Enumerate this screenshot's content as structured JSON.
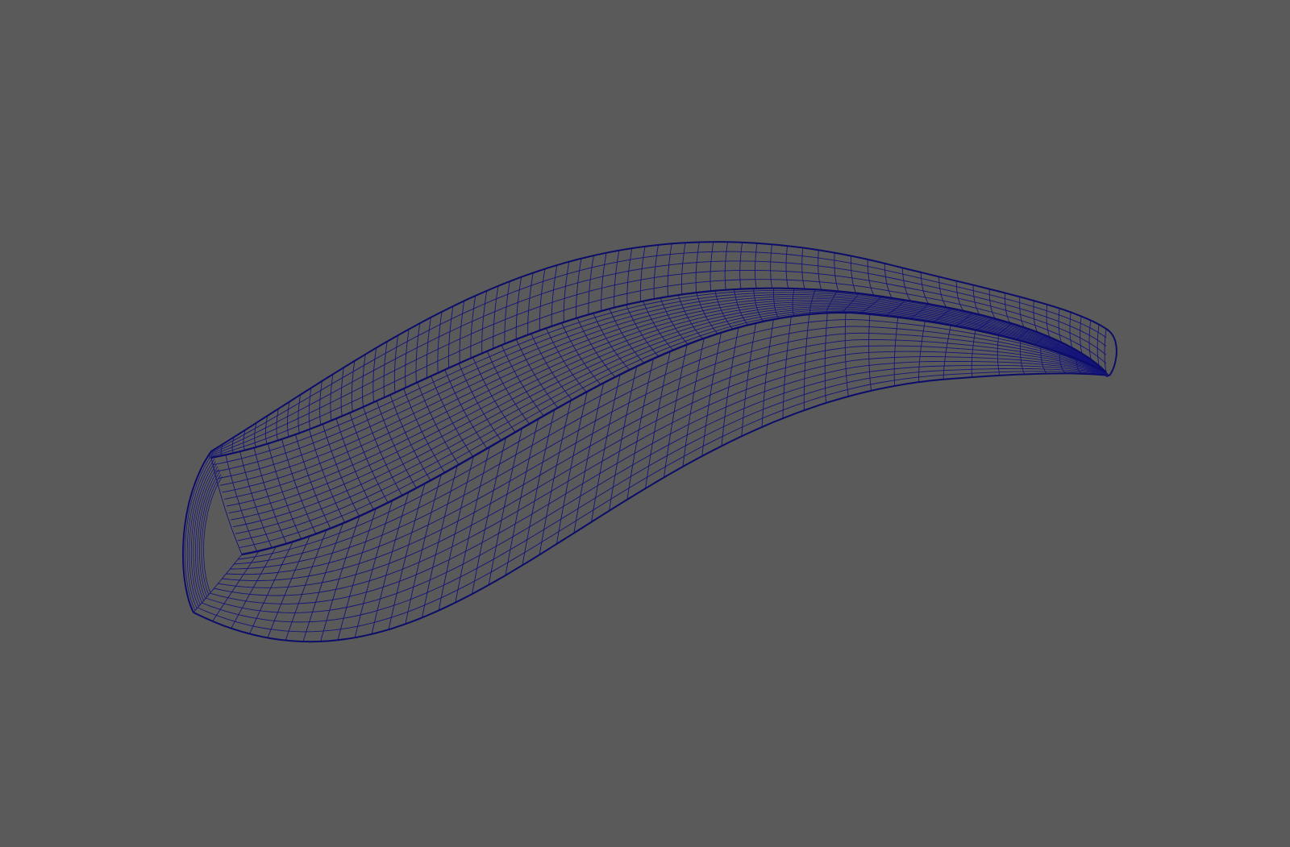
{
  "viewport": {
    "background_color": "#5a5a5a",
    "display_mode": "wireframe"
  },
  "mesh": {
    "object": "curved-surface-body",
    "wire_color": "#14147a",
    "edge_color": "#0c0c6a",
    "icon": "wireframe-mesh-icon"
  }
}
